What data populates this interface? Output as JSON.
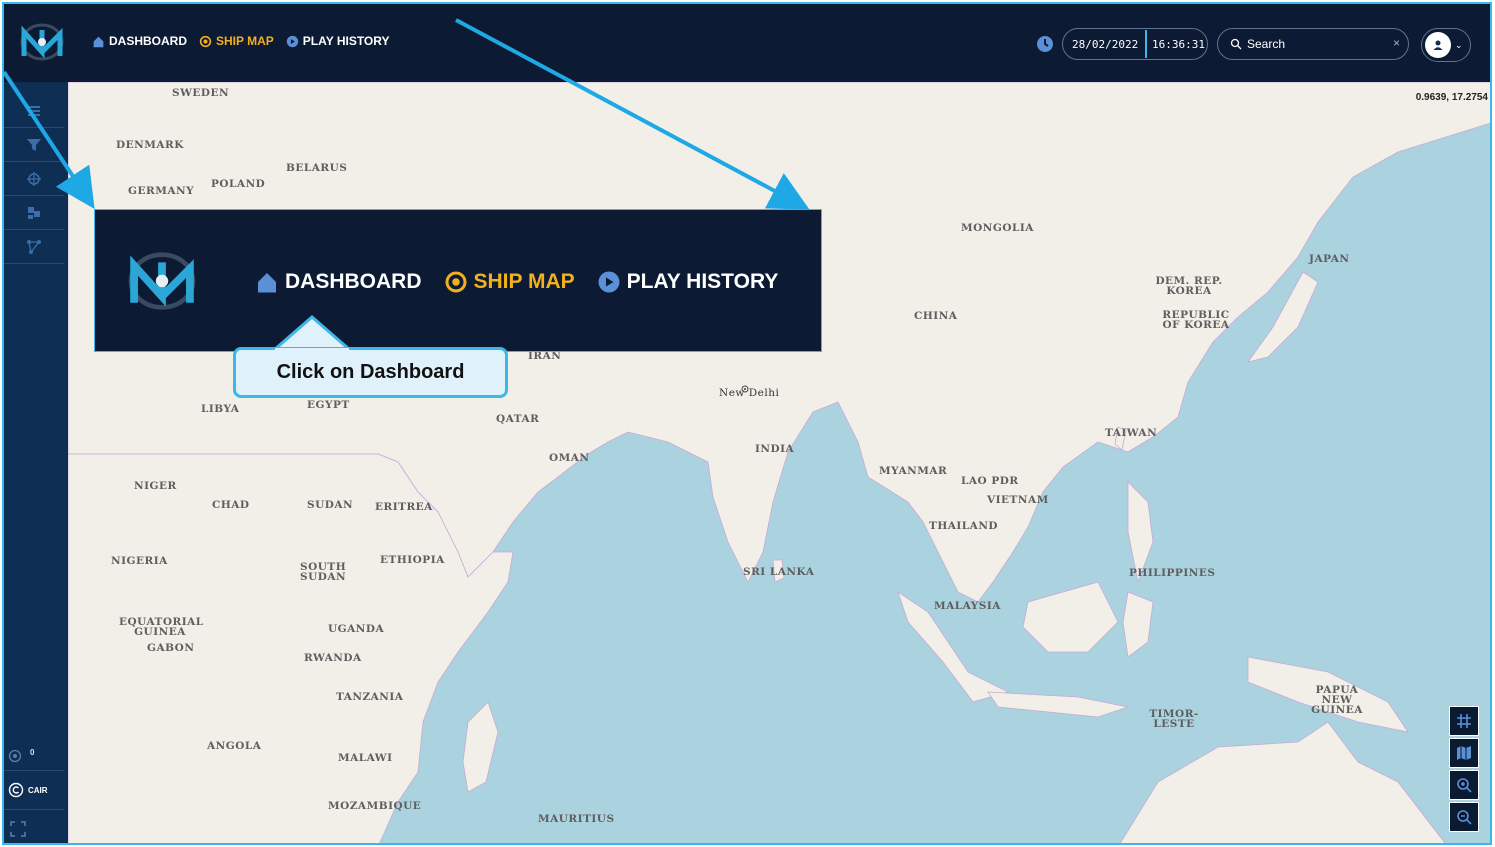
{
  "topbar": {
    "nav": [
      {
        "label": "DASHBOARD",
        "icon": "home-icon"
      },
      {
        "label": "SHIP MAP",
        "icon": "target-icon",
        "active": true
      },
      {
        "label": "PLAY HISTORY",
        "icon": "play-icon"
      }
    ],
    "date": "28/02/2022",
    "time": "16:36:31",
    "search_placeholder": "Search",
    "search_clear": "×"
  },
  "sidebar": {
    "items": [
      "menu-icon",
      "filter-icon",
      "target-icon",
      "layers-icon",
      "network-icon"
    ],
    "bottom": [
      {
        "icon": "radar-icon",
        "label": "0"
      },
      {
        "icon": "copyright-icon",
        "label": "CAIR"
      },
      {
        "icon": "fullscreen-icon",
        "label": ""
      }
    ]
  },
  "map": {
    "coordinates": "0.9639, 17.2754",
    "labels": [
      "SWEDEN",
      "DENMARK",
      "BELARUS",
      "GERMANY",
      "POLAND",
      "MONGOLIA",
      "JAPAN",
      "DEM. REP. KOREA",
      "REPUBLIC OF KOREA",
      "CHINA",
      "IRAN",
      "New Delhi",
      "LIBYA",
      "EGYPT",
      "QATAR",
      "INDIA",
      "TAIWAN",
      "OMAN",
      "MYANMAR",
      "LAO PDR",
      "NIGER",
      "VIETNAM",
      "CHAD",
      "SUDAN",
      "ERITREA",
      "THAILAND",
      "NIGERIA",
      "ETHIOPIA",
      "SOUTH SUDAN",
      "SRI LANKA",
      "PHILIPPINES",
      "MALAYSIA",
      "EQUATORIAL GUINEA",
      "UGANDA",
      "GABON",
      "RWANDA",
      "TANZANIA",
      "PAPUA NEW GUINEA",
      "TIMOR-LESTE",
      "ANGOLA",
      "MALAWI",
      "MOZAMBIQUE",
      "MAURITIUS"
    ],
    "controls": [
      "grid-icon",
      "map-icon",
      "zoom-in-icon",
      "zoom-out-icon"
    ]
  },
  "callout": {
    "nav": [
      "DASHBOARD",
      "SHIP MAP",
      "PLAY HISTORY"
    ],
    "tooltip": "Click on Dashboard"
  },
  "colors": {
    "topbar": "#0c1b33",
    "accent": "#f2b01e",
    "highlight": "#3fb6e8",
    "water": "#aad3df",
    "land": "#f2efe9"
  }
}
